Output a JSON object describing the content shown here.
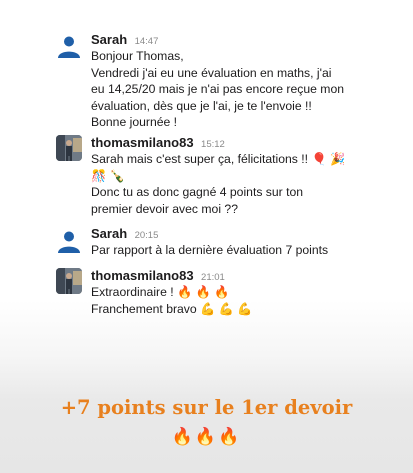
{
  "messages": [
    {
      "author": "Sarah",
      "time": "14:47",
      "lines": [
        "Bonjour Thomas,",
        "Vendredi j'ai eu une évaluation en maths, j'ai",
        "eu 14,25/20 mais je n'ai pas encore reçue mon",
        "évaluation, dès que je l'ai, je te l'envoie !!",
        "Bonne journée !"
      ]
    },
    {
      "author": "thomasmilano83",
      "time": "15:12",
      "lines": [
        "Sarah mais c'est super ça, félicitations !! 🎈 🎉",
        "🎊 🍾",
        "Donc tu as donc gagné 4 points sur ton",
        "premier devoir avec moi ??"
      ]
    },
    {
      "author": "Sarah",
      "time": "20:15",
      "lines": [
        "Par rapport à la dernière évaluation 7 points"
      ]
    },
    {
      "author": "thomasmilano83",
      "time": "21:01",
      "lines": [
        "Extraordinaire ! 🔥 🔥 🔥",
        "Franchement bravo 💪 💪 💪"
      ]
    }
  ],
  "banner": {
    "headline": "+7 points sur le 1er devoir",
    "emoji": "🔥🔥🔥"
  },
  "colors": {
    "accent": "#e8801e",
    "avatar_default": "#1f5fa8",
    "text": "#1d1c1d",
    "timestamp": "#8a8a8a"
  },
  "icons": {
    "default_avatar": "person-silhouette-icon",
    "user_avatar": "profile-photo"
  }
}
